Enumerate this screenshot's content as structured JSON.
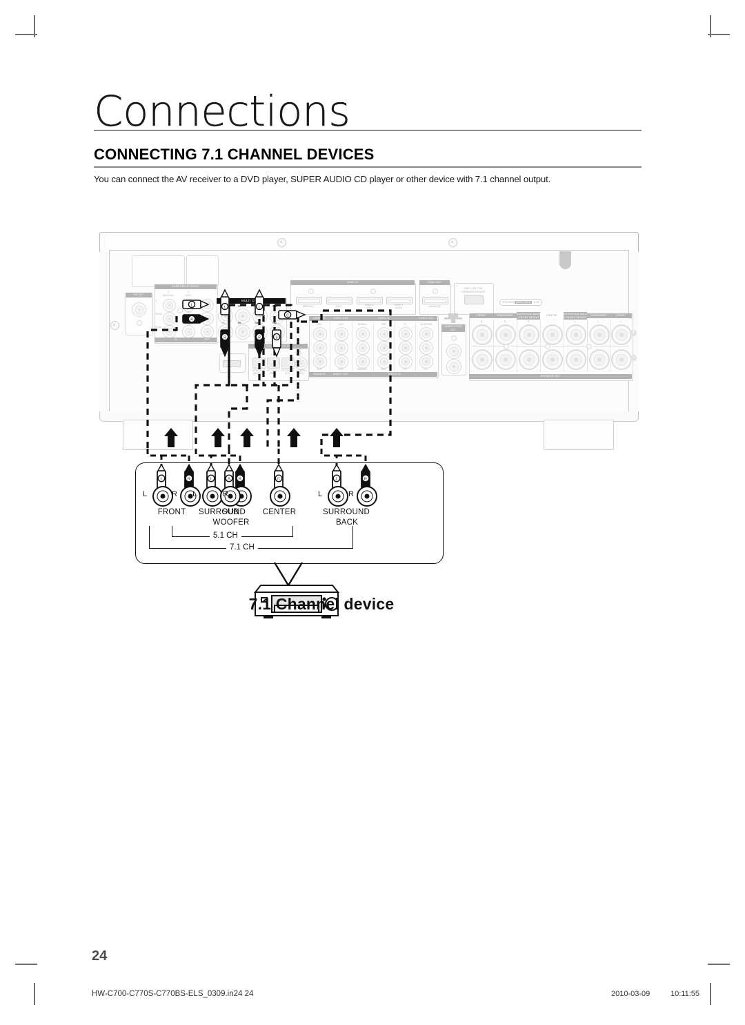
{
  "page": {
    "chapter_title": "Connections",
    "section_title": "CONNECTING 7.1 CHANNEL DEVICES",
    "intro_text": "You can connect the AV receiver to a DVD player, SUPER AUDIO CD player or other device with 7.1 channel output.",
    "page_number": "24"
  },
  "footer": {
    "file_name": "HW-C700-C770S-C770BS-ELS_0309.in24   24",
    "date": "2010-03-09",
    "time": "10:11:55"
  },
  "diagram": {
    "device_caption": "7.1 Channel device",
    "receiver": {
      "panels": {
        "fm_ant": "FM ANT",
        "component": {
          "header": "COMPONENT IN/OUT",
          "col1_num": "1",
          "col1_name": "(BD/DVD)",
          "col2_num": "2",
          "col2_name": "(SAT)",
          "rows": [
            "Y",
            "Pb/Cb",
            "Pr/Cr"
          ],
          "foot_in": "IN",
          "foot_out": "OUT"
        },
        "multi_ch": {
          "header": "MULTI CH IN",
          "top_labels": [
            "FL",
            "SL",
            "SBL",
            "CEN"
          ],
          "bottom_labels": [
            "FR",
            "SR",
            "SBR",
            "SW"
          ]
        },
        "hdmi_in": {
          "header": "HDMI IN",
          "ports": [
            "(BD/DVD)",
            "(SAT)",
            "HDMI 3\n(TV)",
            "HDMI 4\n(AUX)"
          ]
        },
        "hdmi_out": {
          "header": "HDMI OUT",
          "port": "MONITOR"
        },
        "firmware": {
          "note": "ONLY USE FOR\nFIRMWARE UPDATE"
        },
        "digital_in": {
          "header": "DIGITAL AUDIO IN",
          "ports": [
            "OPTICAL 1\n(BD/DVD)",
            "OPTICAL 2\n(SAT)",
            "OPTICAL 3\n(TV)",
            "COAXIAL\n(CD)"
          ]
        },
        "video": {
          "head_in1": "VIDEO IN",
          "head_out1": "VIDEO OUT",
          "head_in2": "VIDEO IN",
          "head_out2": "VIDEO OUT",
          "top_labels": [
            "VCR",
            "VCR",
            "BD/DVD",
            "SAT",
            "TV",
            "MONITOR"
          ],
          "bottom_labels": [
            "VCR",
            "VCR",
            "BD/DVD",
            "SAT",
            "TV",
            "CD"
          ],
          "foot_audio_in": "AUDIO IN",
          "foot_audio_out": "AUDIO OUT",
          "foot_audio_in2": "AUDIO IN"
        },
        "subwoofer_out": "SUBWOOFER\nOUT",
        "impedance_note": "SPEAKER IMPEDANCE : 6-8Ω",
        "speaker_out": {
          "footer": "SPEAKER OUT",
          "groups": [
            {
              "name": "FRONT",
              "ch": "R"
            },
            {
              "name": "SURROUND",
              "ch": "R"
            },
            {
              "name": "SURROUND BACK\n/ FRONT HEIGHT",
              "ch": "R"
            },
            {
              "name": "CENTER",
              "ch": ""
            },
            {
              "name": "SURROUND BACK\n/ FRONT HEIGHT",
              "ch": "L"
            },
            {
              "name": "SURROUND",
              "ch": "L"
            },
            {
              "name": "FRONT",
              "ch": "L"
            }
          ],
          "plus": "+",
          "minus": "−"
        }
      }
    },
    "speaker_terminals": {
      "groups": [
        {
          "name": "FRONT",
          "name2": "",
          "left": "L",
          "right": "R",
          "plugs": [
            "L",
            "R"
          ]
        },
        {
          "name": "SURROUND",
          "name2": "",
          "left": "L",
          "right": "R",
          "plugs": [
            "L",
            "R"
          ]
        },
        {
          "name": "SUB",
          "name2": "WOOFER",
          "left": "",
          "right": "",
          "plugs": [
            "SW"
          ]
        },
        {
          "name": "CENTER",
          "name2": "",
          "left": "",
          "right": "",
          "plugs": [
            "C"
          ]
        },
        {
          "name": "SURROUND",
          "name2": "BACK",
          "left": "L",
          "right": "R",
          "plugs": [
            "L",
            "R"
          ]
        }
      ],
      "bracket_51": "5.1 CH",
      "bracket_71": "7.1 CH"
    }
  }
}
